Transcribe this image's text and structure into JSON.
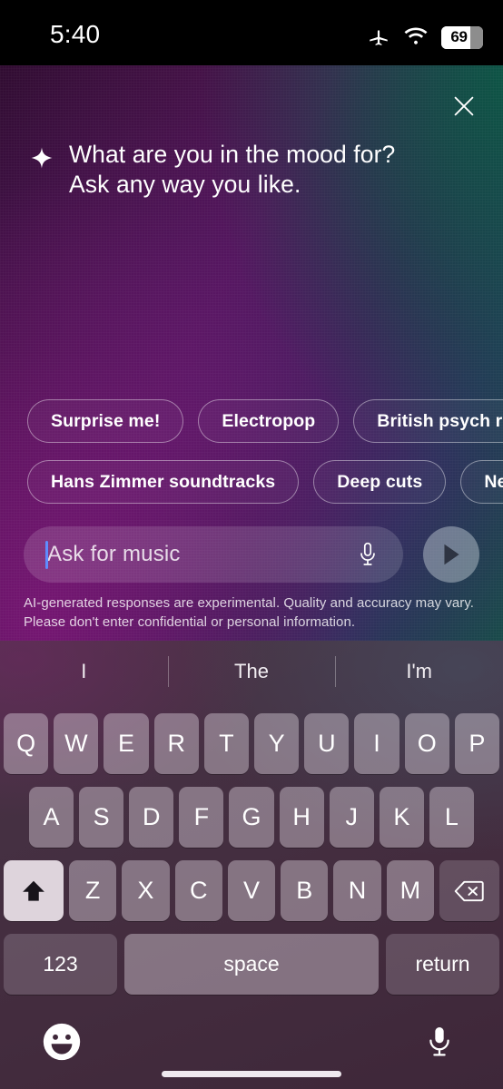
{
  "status_bar": {
    "time": "5:40",
    "battery_percent": "69",
    "icons": [
      "airplane-mode-icon",
      "wifi-icon",
      "battery-icon"
    ]
  },
  "assistant": {
    "close_label": "close-icon",
    "sparkle": "sparkle-icon",
    "headline_line1": "What are you in the mood for?",
    "headline_line2": "Ask any way you like.",
    "disclaimer": "AI-generated responses are experimental. Quality and accuracy may vary. Please don't enter confidential or personal information."
  },
  "suggestion_chips": {
    "row1": [
      {
        "label": "Surprise me!"
      },
      {
        "label": "Electropop"
      },
      {
        "label": "British psych rock"
      }
    ],
    "row2": [
      {
        "label": "Hans Zimmer soundtracks"
      },
      {
        "label": "Deep cuts"
      },
      {
        "label": "New releases"
      }
    ]
  },
  "input": {
    "placeholder": "Ask for music",
    "value": "",
    "mic_icon": "microphone-icon",
    "send_icon": "play-icon",
    "cursor_color": "#5e8dff"
  },
  "keyboard": {
    "predictions": [
      "I",
      "The",
      "I'm"
    ],
    "row1": [
      "Q",
      "W",
      "E",
      "R",
      "T",
      "Y",
      "U",
      "I",
      "O",
      "P"
    ],
    "row2": [
      "A",
      "S",
      "D",
      "F",
      "G",
      "H",
      "J",
      "K",
      "L"
    ],
    "row3_letters": [
      "Z",
      "X",
      "C",
      "V",
      "B",
      "N",
      "M"
    ],
    "shift_label": "shift-arrow-icon",
    "shift_state": "active",
    "backspace_label": "backspace-icon",
    "numeric_label": "123",
    "space_label": "space",
    "return_label": "return",
    "emoji_label": "emoji-smiley-icon",
    "dictation_label": "microphone-icon"
  },
  "colors": {
    "gradient_top_left": "#2a0a28",
    "gradient_mid": "#4e1352",
    "gradient_top_right": "#0c5644",
    "keyboard_bg": "#432c3f",
    "key_bg": "#8b7a89",
    "accent_cursor": "#5e8dff",
    "send_button": "#7d8590"
  }
}
